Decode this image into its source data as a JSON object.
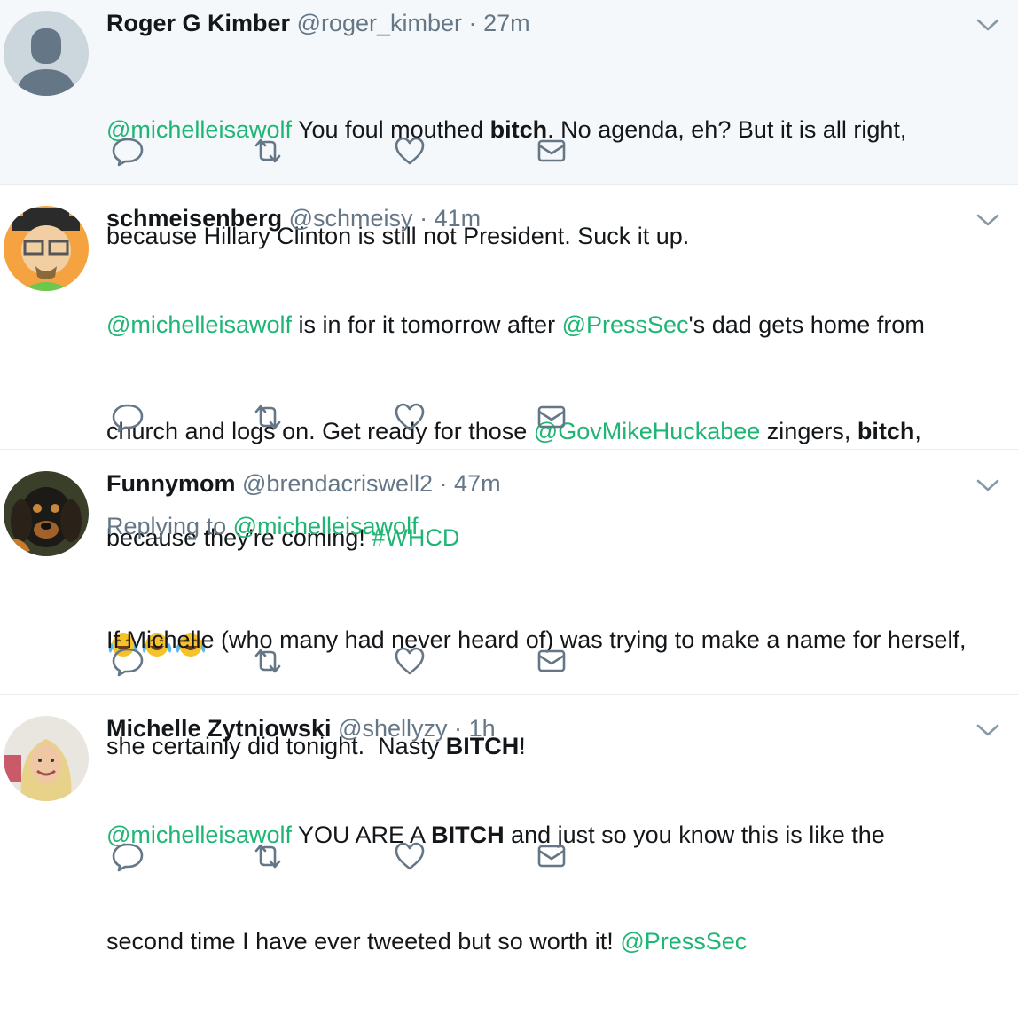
{
  "colors": {
    "mention": "#1fb575",
    "muted": "#657786",
    "text": "#14171a",
    "highlight_bg": "#f5f8fa"
  },
  "icons": {
    "reply": "reply-icon",
    "retweet": "retweet-icon",
    "like": "heart-icon",
    "dm": "envelope-icon",
    "more": "chevron-down-icon",
    "emoji": "face-with-tears-of-joy-icon"
  },
  "tweets": [
    {
      "name": "Roger G Kimber",
      "handle": "@roger_kimber",
      "dot": "·",
      "time": "27m",
      "lines": [
        [
          {
            "t": "@michelleisawolf",
            "k": "mention"
          },
          {
            "t": " You foul mouthed ",
            "k": "plain"
          },
          {
            "t": "bitch",
            "k": "bold"
          },
          {
            "t": ". No agenda, eh? But it is all right,",
            "k": "plain"
          }
        ],
        [
          {
            "t": "because Hillary Clinton is still not President. Suck it up.",
            "k": "plain"
          }
        ]
      ]
    },
    {
      "name": "schmeisenberg",
      "handle": "@schmeisy",
      "dot": "·",
      "time": "41m",
      "lines": [
        [
          {
            "t": "@michelleisawolf",
            "k": "mention"
          },
          {
            "t": " is in for it tomorrow after ",
            "k": "plain"
          },
          {
            "t": "@PressSec",
            "k": "mention"
          },
          {
            "t": "'s dad gets home from",
            "k": "plain"
          }
        ],
        [
          {
            "t": "church and logs on. Get ready for those ",
            "k": "plain"
          },
          {
            "t": "@GovMikeHuckabee",
            "k": "mention"
          },
          {
            "t": " zingers, ",
            "k": "plain"
          },
          {
            "t": "bitch",
            "k": "bold"
          },
          {
            "t": ",",
            "k": "plain"
          }
        ],
        [
          {
            "t": "because they're coming! ",
            "k": "plain"
          },
          {
            "t": "#WHCD",
            "k": "hashtag"
          }
        ]
      ],
      "emoji_count": 3
    },
    {
      "name": "Funnymom",
      "handle": "@brendacriswell2",
      "dot": "·",
      "time": "47m",
      "replying_label": "Replying to ",
      "replying_to": "@michelleisawolf",
      "lines": [
        [
          {
            "t": "If Michelle (who many had never heard of) was trying to make a name for herself,",
            "k": "plain"
          }
        ],
        [
          {
            "t": "she certainly did tonight.  Nasty ",
            "k": "plain"
          },
          {
            "t": "BITCH",
            "k": "bold"
          },
          {
            "t": "!",
            "k": "plain"
          }
        ]
      ]
    },
    {
      "name": "Michelle Zytniowski",
      "handle": "@shellyzy",
      "dot": "·",
      "time": "1h",
      "lines": [
        [
          {
            "t": "@michelleisawolf",
            "k": "mention"
          },
          {
            "t": " YOU ARE A ",
            "k": "plain"
          },
          {
            "t": "BITCH",
            "k": "bold"
          },
          {
            "t": " and just so you know this is like the",
            "k": "plain"
          }
        ],
        [
          {
            "t": "second time I have ever tweeted but so worth it! ",
            "k": "plain"
          },
          {
            "t": "@PressSec",
            "k": "mention"
          }
        ]
      ]
    }
  ]
}
